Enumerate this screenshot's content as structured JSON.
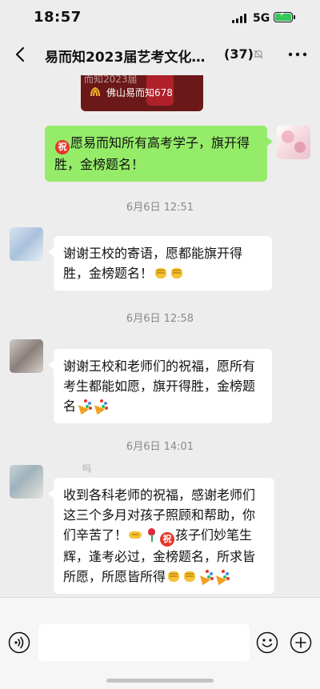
{
  "status_bar": {
    "time": "18:57",
    "network": "5G"
  },
  "nav": {
    "title": "易而知2023届艺考文化…",
    "member_count": "(37)"
  },
  "link_card": {
    "background_text": "而知2023届",
    "source": "佛山易而知678"
  },
  "messages": [
    {
      "side": "sent",
      "text": "愿易而知所有高考学子，旗开得胜，金榜题名！",
      "emoji_lead": "祝"
    },
    {
      "side": "received",
      "text": "谢谢王校的寄语，愿都能旗开得胜，金榜题名！"
    },
    {
      "side": "received",
      "text": "谢谢王校和老师们的祝福，愿所有考生都能如愿，旗开得胜，金榜题名"
    },
    {
      "side": "received",
      "text_part1": "收到各科老师的祝福，感谢老师们这三个多月对孩子照顾和帮助，你们辛苦了！",
      "emoji_zhu": "祝",
      "text_part2": "孩子们妙笔生辉，逢考必过，金榜题名，所求皆所愿，所愿皆所得"
    }
  ],
  "timestamps": [
    "6月6日 12:51",
    "6月6日 12:58",
    "6月6日 14:01"
  ],
  "nickname_fragment": "吗",
  "colors": {
    "sent_bubble": "#95ec69",
    "received_bubble": "#ffffff",
    "chat_background": "#ededed"
  },
  "icons": [
    "back-arrow-icon",
    "mute-bell-icon",
    "more-icon",
    "voice-icon",
    "emoji-icon",
    "add-icon"
  ]
}
